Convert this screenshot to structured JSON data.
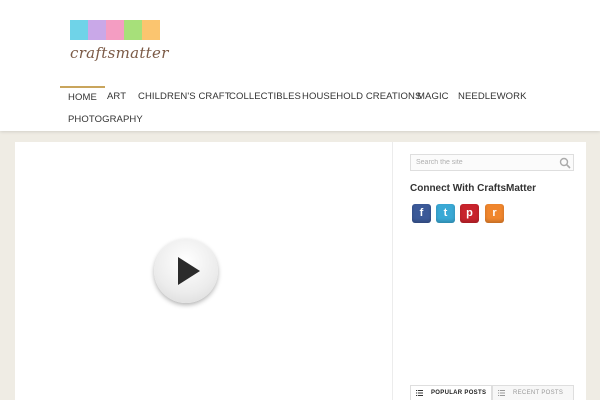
{
  "site": {
    "logo_text": "craftsmatter",
    "logo_colors": [
      "#6fd3e8",
      "#c9a8e8",
      "#f49dc2",
      "#a7e07a",
      "#fbc56f"
    ]
  },
  "nav": {
    "items": [
      {
        "label": "HOME",
        "active": true
      },
      {
        "label": "ART"
      },
      {
        "label": "CHILDREN'S CRAFT"
      },
      {
        "label": "COLLECTIBLES"
      },
      {
        "label": "HOUSEHOLD CREATIONS"
      },
      {
        "label": "MAGIC"
      },
      {
        "label": "NEEDLEWORK"
      },
      {
        "label": "PHOTOGRAPHY"
      }
    ],
    "active_color": "#c9a55c"
  },
  "main": {
    "video": {
      "play_icon": "play-icon"
    }
  },
  "sidebar": {
    "search": {
      "placeholder": "Search the site",
      "icon": "search-icon"
    },
    "connect_title": "Connect With CraftsMatter",
    "social": [
      {
        "name": "facebook-icon",
        "glyph": "f",
        "color": "#3b5998"
      },
      {
        "name": "twitter-icon",
        "glyph": "t",
        "color": "#3aa9d5"
      },
      {
        "name": "pinterest-icon",
        "glyph": "p",
        "color": "#c8232c"
      },
      {
        "name": "rss-icon",
        "glyph": "r",
        "color": "#f0862d"
      }
    ],
    "tabs": [
      {
        "label": "POPULAR POSTS",
        "active": true,
        "icon": "list-icon"
      },
      {
        "label": "RECENT POSTS",
        "active": false,
        "icon": "list-icon"
      }
    ]
  }
}
